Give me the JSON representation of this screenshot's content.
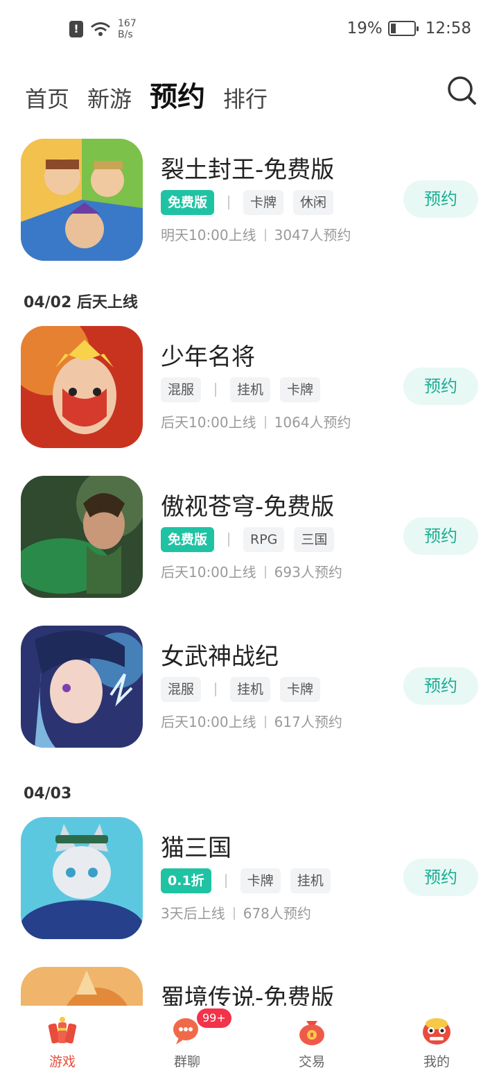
{
  "status_bar": {
    "net_speed_value": "167",
    "net_speed_unit": "B/s",
    "battery": "19%",
    "time": "12:58"
  },
  "tabs": [
    {
      "label": "首页"
    },
    {
      "label": "新游"
    },
    {
      "label": "预约"
    },
    {
      "label": "排行"
    }
  ],
  "active_tab": "预约",
  "sections": [
    {
      "header": "04/02 后天上线"
    },
    {
      "header": "04/03"
    }
  ],
  "games": [
    {
      "name": "裂土封王-免费版",
      "tags": {
        "highlight": "免费版",
        "t1": "卡牌",
        "t2": "休闲"
      },
      "launch": "明天10:00上线",
      "reservations": "3047人预约",
      "button": "预约"
    },
    {
      "name": "少年名将",
      "tags": {
        "highlight": "混服",
        "t1": "挂机",
        "t2": "卡牌"
      },
      "launch": "后天10:00上线",
      "reservations": "1064人预约",
      "button": "预约"
    },
    {
      "name": "傲视苍穹-免费版",
      "tags": {
        "highlight": "免费版",
        "t1": "RPG",
        "t2": "三国"
      },
      "launch": "后天10:00上线",
      "reservations": "693人预约",
      "button": "预约"
    },
    {
      "name": "女武神战纪",
      "tags": {
        "highlight": "混服",
        "t1": "挂机",
        "t2": "卡牌"
      },
      "launch": "后天10:00上线",
      "reservations": "617人预约",
      "button": "预约"
    },
    {
      "name": "猫三国",
      "tags": {
        "highlight": "0.1折",
        "t1": "卡牌",
        "t2": "挂机"
      },
      "launch": "3天后上线",
      "reservations": "678人预约",
      "button": "预约"
    },
    {
      "name": "蜀境传说-免费版"
    }
  ],
  "bottom_nav": [
    {
      "label": "游戏",
      "icon": "firecracker-icon"
    },
    {
      "label": "群聊",
      "icon": "chat-bubble-icon",
      "badge": "99+"
    },
    {
      "label": "交易",
      "icon": "money-bag-icon"
    },
    {
      "label": "我的",
      "icon": "lion-mask-icon"
    }
  ],
  "colors": {
    "accent": "#1fc3a3",
    "button_bg": "#e8f8f5",
    "button_text": "#1aae93",
    "nav_active": "#e94c3d",
    "badge": "#f2334a"
  }
}
